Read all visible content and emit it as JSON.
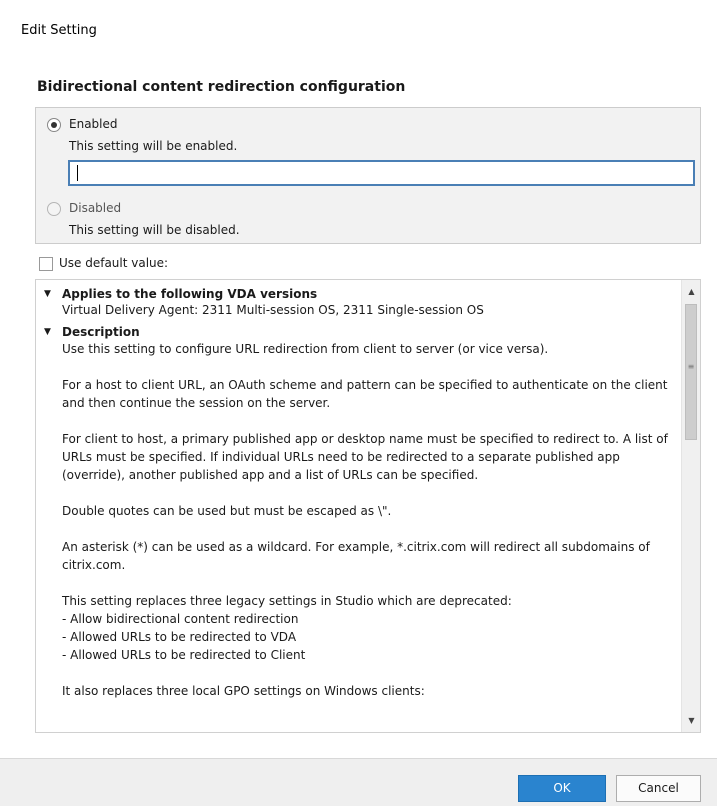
{
  "window": {
    "title": "Edit Setting"
  },
  "setting": {
    "title": "Bidirectional content redirection configuration",
    "enabled": {
      "label": "Enabled",
      "description": "This setting will be enabled.",
      "selected": true,
      "input_value": ""
    },
    "disabled": {
      "label": "Disabled",
      "description": "This setting will be disabled.",
      "selected": false
    },
    "use_default": {
      "label": "Use default value:",
      "checked": false
    }
  },
  "info": {
    "applies_heading": "Applies to the following VDA versions",
    "applies_text": "Virtual Delivery Agent: 2311 Multi-session OS, 2311 Single-session OS",
    "description_heading": "Description",
    "paragraphs": [
      "Use this setting to configure URL redirection from client to server (or vice versa).",
      "For a host to client URL, an OAuth scheme and pattern can be specified to authenticate on the client and then continue the session on the server.",
      "For client to host, a primary published app or desktop name must be specified to redirect to.  A list of URLs must be specified.  If individual URLs need to be redirected to a separate published app (override), another published app and a list of URLs can be specified.",
      "Double quotes can be used but must be escaped as \\\".",
      "An asterisk (*) can be used as a wildcard.  For example, *.citrix.com will redirect all subdomains of citrix.com."
    ],
    "legacy_intro": "This setting replaces three legacy settings in Studio which are deprecated:",
    "legacy_items": [
      "- Allow bidirectional content redirection",
      "- Allowed URLs to be redirected to VDA",
      "- Allowed URLs to be redirected to Client"
    ],
    "gpo_intro": "It also replaces three local GPO settings on Windows clients:"
  },
  "buttons": {
    "ok": "OK",
    "cancel": "Cancel"
  },
  "colors": {
    "ok_button": "#2a84cf",
    "input_border": "#4a7fb5",
    "option_group_bg": "#f2f2f2"
  }
}
